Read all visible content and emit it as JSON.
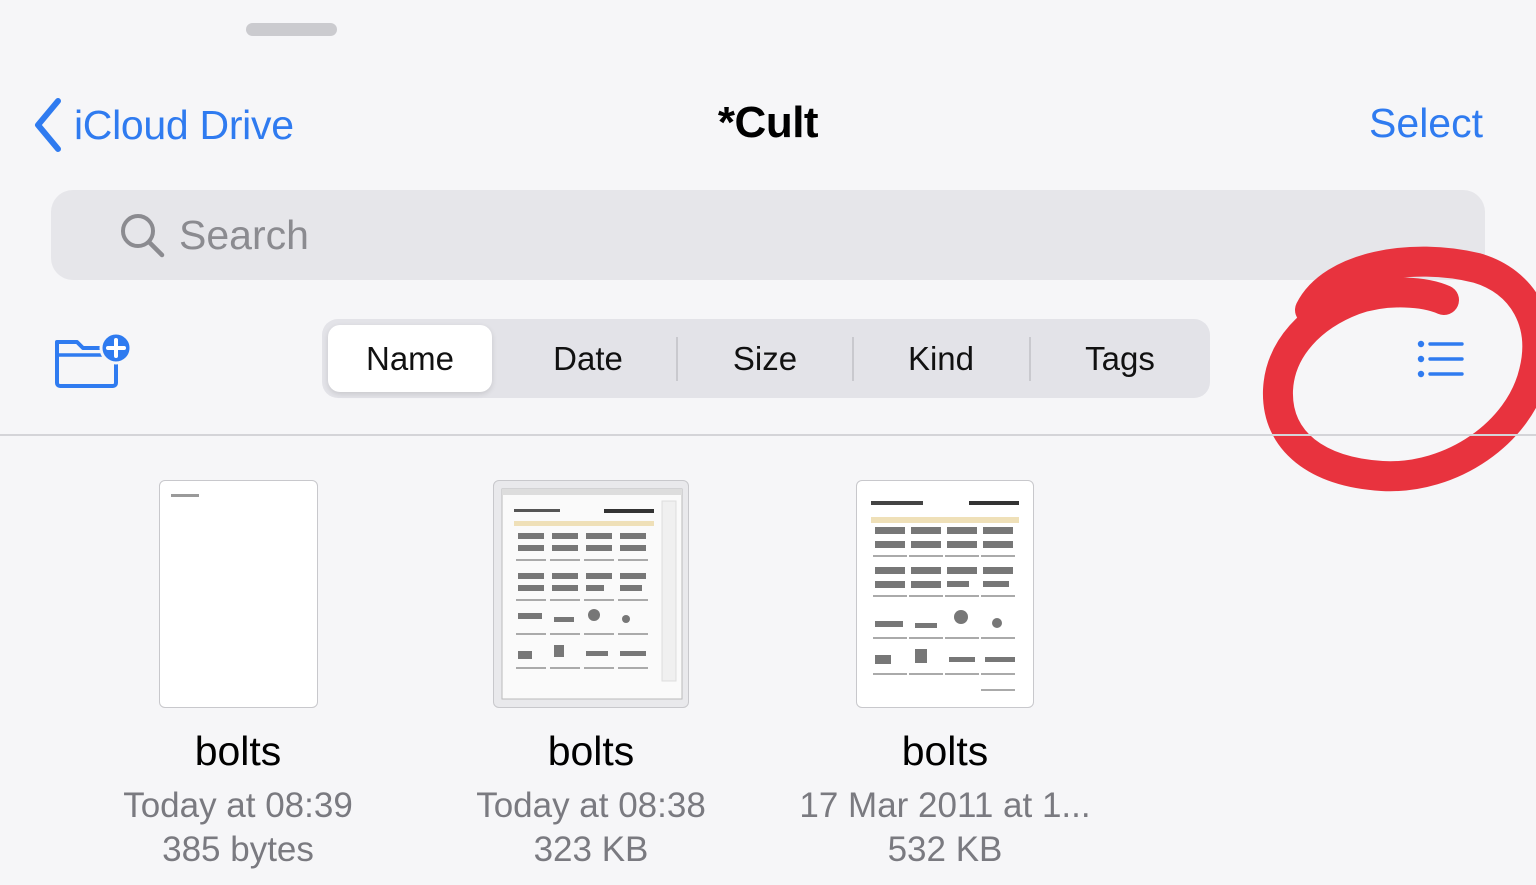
{
  "nav": {
    "back_label": "iCloud Drive",
    "title": "*Cult",
    "select_label": "Select"
  },
  "search": {
    "placeholder": "Search"
  },
  "sort": {
    "options": [
      "Name",
      "Date",
      "Size",
      "Kind",
      "Tags"
    ],
    "selected": "Name"
  },
  "icons": [
    "chevron-left-icon",
    "search-icon",
    "new-folder-icon",
    "list-view-icon"
  ],
  "colors": {
    "accent": "#2f7bf0",
    "annotation": "#e8333e",
    "background": "#f6f6f8"
  },
  "files": [
    {
      "name": "bolts",
      "date": "Today at 08:39",
      "size": "385 bytes"
    },
    {
      "name": "bolts",
      "date": "Today at 08:38",
      "size": "323 KB"
    },
    {
      "name": "bolts",
      "date": "17 Mar 2011 at 1...",
      "size": "532 KB"
    }
  ]
}
